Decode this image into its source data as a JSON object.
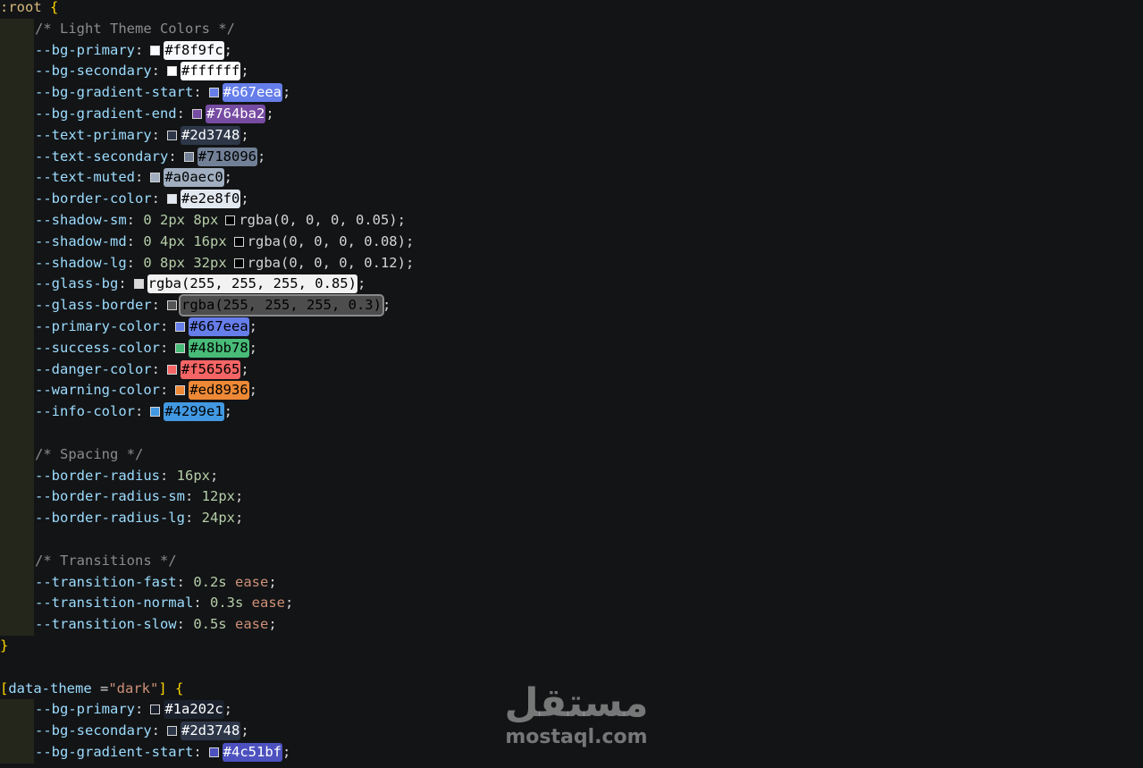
{
  "colors": {
    "background": "#131416",
    "brace": "#ffd700",
    "property": "#9cdcfe",
    "comment": "#6a9955",
    "number": "#b5cea8",
    "keyword": "#ce9178",
    "indent_guide": "#24261c"
  },
  "code": {
    "root_selector": ":root",
    "open_brace": "{",
    "close_brace": "}",
    "comment_light": "/* Light Theme Colors */",
    "comment_spacing": "/* Spacing */",
    "comment_transitions": "/* Transitions */",
    "light_vars": [
      {
        "name": "--bg-primary",
        "value": "#f8f9fc",
        "swatch": "#f8f9fc",
        "chip_bg": "#f8f9fc",
        "chip_fg": "#000000"
      },
      {
        "name": "--bg-secondary",
        "value": "#ffffff",
        "swatch": "#ffffff",
        "chip_bg": "#ffffff",
        "chip_fg": "#000000"
      },
      {
        "name": "--bg-gradient-start",
        "value": "#667eea",
        "swatch": "#667eea",
        "chip_bg": "#667eea",
        "chip_fg": "#ffffff"
      },
      {
        "name": "--bg-gradient-end",
        "value": "#764ba2",
        "swatch": "#764ba2",
        "chip_bg": "#764ba2",
        "chip_fg": "#ffffff"
      },
      {
        "name": "--text-primary",
        "value": "#2d3748",
        "swatch": "#2d3748",
        "chip_bg": "#2d3748",
        "chip_fg": "#ffffff"
      },
      {
        "name": "--text-secondary",
        "value": "#718096",
        "swatch": "#718096",
        "chip_bg": "#718096",
        "chip_fg": "#000000"
      },
      {
        "name": "--text-muted",
        "value": "#a0aec0",
        "swatch": "#a0aec0",
        "chip_bg": "#a0aec0",
        "chip_fg": "#000000"
      },
      {
        "name": "--border-color",
        "value": "#e2e8f0",
        "swatch": "#e2e8f0",
        "chip_bg": "#e2e8f0",
        "chip_fg": "#000000"
      }
    ],
    "shadow_vars": [
      {
        "name": "--shadow-sm",
        "prefix": "0 2px 8px",
        "value": "rgba(0, 0, 0, 0.05);"
      },
      {
        "name": "--shadow-md",
        "prefix": "0 4px 16px",
        "value": "rgba(0, 0, 0, 0.08);"
      },
      {
        "name": "--shadow-lg",
        "prefix": "0 8px 32px",
        "value": "rgba(0, 0, 0, 0.12);"
      }
    ],
    "glass_bg": {
      "name": "--glass-bg",
      "value": "rgba(255, 255, 255, 0.85)",
      "swatch": "#d9d9d9",
      "chip_bg": "#f2f2f2",
      "chip_fg": "#000000"
    },
    "glass_border": {
      "name": "--glass-border",
      "value": "rgba(255, 255, 255, 0.3)",
      "swatch": "#555555",
      "chip_bg": "#4d4d4d",
      "chip_fg": "#000000"
    },
    "status_vars": [
      {
        "name": "--primary-color",
        "value": "#667eea",
        "swatch": "#667eea",
        "chip_bg": "#667eea",
        "chip_fg": "#000000"
      },
      {
        "name": "--success-color",
        "value": "#48bb78",
        "swatch": "#48bb78",
        "chip_bg": "#48bb78",
        "chip_fg": "#000000"
      },
      {
        "name": "--danger-color",
        "value": "#f56565",
        "swatch": "#f56565",
        "chip_bg": "#f56565",
        "chip_fg": "#000000"
      },
      {
        "name": "--warning-color",
        "value": "#ed8936",
        "swatch": "#ed8936",
        "chip_bg": "#ed8936",
        "chip_fg": "#000000"
      },
      {
        "name": "--info-color",
        "value": "#4299e1",
        "swatch": "#4299e1",
        "chip_bg": "#4299e1",
        "chip_fg": "#000000"
      }
    ],
    "spacing_vars": [
      {
        "name": "--border-radius",
        "value": "16px"
      },
      {
        "name": "--border-radius-sm",
        "value": "12px"
      },
      {
        "name": "--border-radius-lg",
        "value": "24px"
      }
    ],
    "transition_vars": [
      {
        "name": "--transition-fast",
        "num": "0.2s",
        "kw": "ease"
      },
      {
        "name": "--transition-normal",
        "num": "0.3s",
        "kw": "ease"
      },
      {
        "name": "--transition-slow",
        "num": "0.5s",
        "kw": "ease"
      }
    ],
    "dark_selector_open": "[",
    "dark_attr": "data-theme",
    "dark_eq": " =",
    "dark_val": "\"dark\"",
    "dark_selector_close": "]",
    "dark_vars": [
      {
        "name": "--bg-primary",
        "value": "#1a202c",
        "swatch": "#1a202c",
        "chip_bg": "#1a202c",
        "chip_fg": "#ffffff"
      },
      {
        "name": "--bg-secondary",
        "value": "#2d3748",
        "swatch": "#2d3748",
        "chip_bg": "#2d3748",
        "chip_fg": "#ffffff"
      },
      {
        "name": "--bg-gradient-start",
        "value": "#4c51bf",
        "swatch": "#4c51bf",
        "chip_bg": "#4c51bf",
        "chip_fg": "#ffffff"
      }
    ]
  },
  "watermark": {
    "logo_mark": "مستقل",
    "logo_text": "mostaql.com"
  }
}
